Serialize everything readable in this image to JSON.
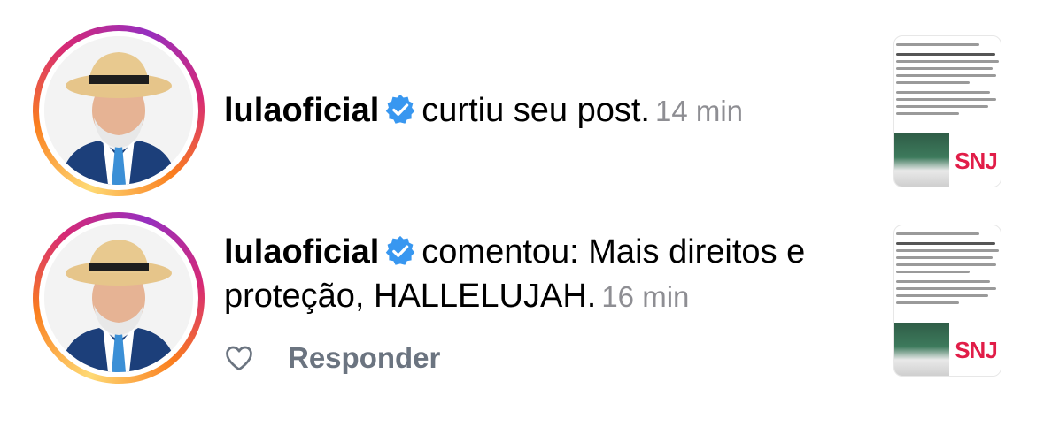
{
  "notifications": [
    {
      "username": "lulaoficial",
      "verified": true,
      "action_text": "curtiu seu post.",
      "time": "14 min",
      "post_thumb_logo": "SNJ"
    },
    {
      "username": "lulaoficial",
      "verified": true,
      "action_text": "comentou: Mais direitos e proteção, HALLELUJAH.",
      "time": "16 min",
      "like_icon": "heart-outline-icon",
      "reply_label": "Responder",
      "post_thumb_logo": "SNJ"
    }
  ],
  "colors": {
    "verified_badge": "#3897f0",
    "timestamp": "#8e8e93",
    "reply_text": "#6b7480",
    "story_ring": [
      "#feda75",
      "#fa7e1e",
      "#d62976",
      "#962fbf"
    ]
  }
}
